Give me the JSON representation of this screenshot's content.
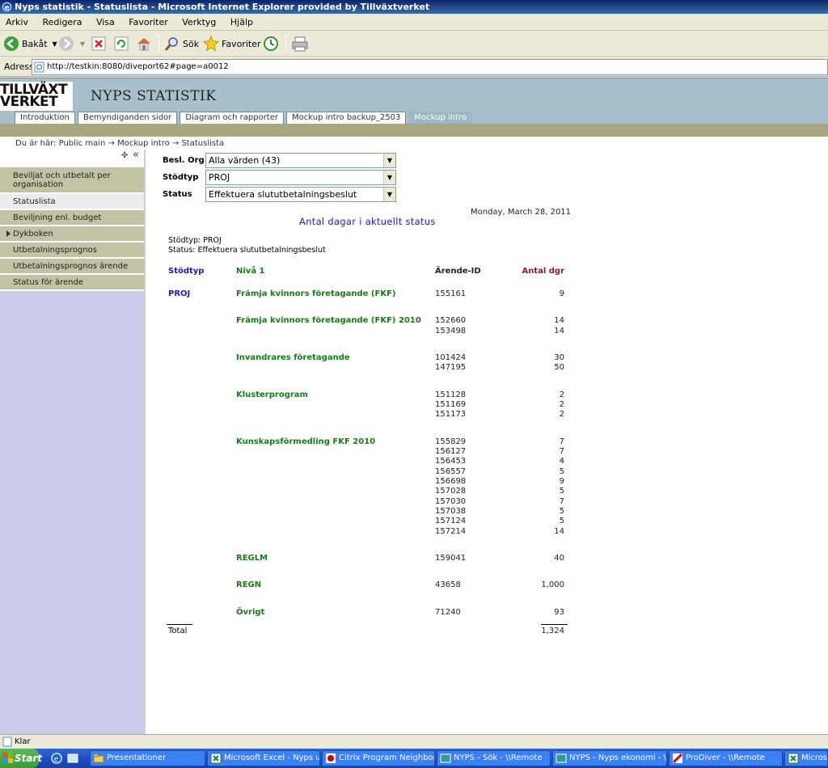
{
  "window": {
    "title": "Nyps statistik - Statuslista - Microsoft Internet Explorer provided by Tillväxtverket"
  },
  "menubar": [
    "Arkiv",
    "Redigera",
    "Visa",
    "Favoriter",
    "Verktyg",
    "Hjälp"
  ],
  "toolbar": {
    "back_label": "Bakåt",
    "search_label": "Sök",
    "favorites_label": "Favoriter"
  },
  "address": {
    "label": "Adress",
    "url": "http://testkin:8080/diveport62#page=a0012"
  },
  "site": {
    "logo_line1": "TILLVÄXT",
    "logo_line2": "VERKET",
    "title": "NYPS STATISTIK",
    "tabs": [
      {
        "label": "Introduktion",
        "active": false
      },
      {
        "label": "Bemyndiganden sidor",
        "active": false
      },
      {
        "label": "Diagram och rapporter",
        "active": false
      },
      {
        "label": "Mockup intro backup_2503",
        "active": false
      },
      {
        "label": "Mockup intro",
        "active": true
      }
    ],
    "breadcrumb": "Du är här: Public main → Mockup intro → Statuslista"
  },
  "sidebar": {
    "items": [
      {
        "label": "Beviljat och utbetalt per organisation",
        "active": false,
        "expandable": false
      },
      {
        "label": "Statuslista",
        "active": true,
        "expandable": false
      },
      {
        "label": "Beviljning enl. budget",
        "active": false,
        "expandable": false
      },
      {
        "label": "Dykboken",
        "active": false,
        "expandable": true
      },
      {
        "label": "Utbetalningsprognos",
        "active": false,
        "expandable": false
      },
      {
        "label": "Utbetalningsprognos ärende",
        "active": false,
        "expandable": false
      },
      {
        "label": "Status för ärende",
        "active": false,
        "expandable": false
      }
    ]
  },
  "filters": {
    "besl_org_label": "Besl. Org",
    "besl_org_value": "Alla värden (43)",
    "stodtyp_label": "Stödtyp",
    "stodtyp_value": "PROJ",
    "status_label": "Status",
    "status_value": "Effektuera slututbetalningsbeslut"
  },
  "report": {
    "date": "Monday, March 28, 2011",
    "title": "Antal dagar i aktuellt status",
    "sub1": "Stödtyp: PROJ",
    "sub2": "Status: Effektuera slututbetalningsbeslut",
    "headers": {
      "stodtyp": "Stödtyp",
      "niva": "Nivå 1",
      "arende": "Ärende-ID",
      "dagar": "Antal dgr"
    },
    "stodtyp_value": "PROJ",
    "groups": [
      {
        "niva": "Främja kvinnors företagande (FKF)",
        "rows": [
          [
            "155161",
            "9"
          ]
        ]
      },
      {
        "niva": "Främja kvinnors företagande (FKF) 2010",
        "rows": [
          [
            "152660",
            "14"
          ],
          [
            "153498",
            "14"
          ]
        ]
      },
      {
        "niva": "Invandrares företagande",
        "rows": [
          [
            "101424",
            "30"
          ],
          [
            "147195",
            "50"
          ]
        ]
      },
      {
        "niva": "Klusterprogram",
        "rows": [
          [
            "151128",
            "2"
          ],
          [
            "151169",
            "2"
          ],
          [
            "151173",
            "2"
          ]
        ]
      },
      {
        "niva": "Kunskapsförmedling FKF 2010",
        "rows": [
          [
            "155829",
            "7"
          ],
          [
            "156127",
            "7"
          ],
          [
            "156453",
            "4"
          ],
          [
            "156557",
            "5"
          ],
          [
            "156698",
            "9"
          ],
          [
            "157028",
            "5"
          ],
          [
            "157030",
            "7"
          ],
          [
            "157038",
            "5"
          ],
          [
            "157124",
            "5"
          ],
          [
            "157214",
            "14"
          ]
        ]
      },
      {
        "niva": "REGLM",
        "rows": [
          [
            "159041",
            "40"
          ]
        ]
      },
      {
        "niva": "REGN",
        "rows": [
          [
            "43658",
            "1,000"
          ]
        ]
      },
      {
        "niva": "Övrigt",
        "rows": [
          [
            "71240",
            "93"
          ]
        ]
      }
    ],
    "total_label": "Total",
    "total_value": "1,324"
  },
  "statusbar": {
    "text": "Klar"
  },
  "taskbar": {
    "start_label": "Start",
    "tasks": [
      "Presentationer",
      "Microsoft Excel - Nyps ut...",
      "Citrix Program Neighborh...",
      "NYPS - Sök - \\\\Remote",
      "NYPS - Nyps ekonomi - \\\\...",
      "ProDiver - \\\\Remote",
      "Microso"
    ]
  },
  "colors": {
    "header_bg": "#a8c0cc",
    "olive_bar": "#a9a77e",
    "nav_bg": "#c2c2a4",
    "panel_bg": "#ccccea",
    "blue_text": "#1a1ad0",
    "green_text": "#1a7a1a",
    "maroon_text": "#8b1a3a"
  }
}
